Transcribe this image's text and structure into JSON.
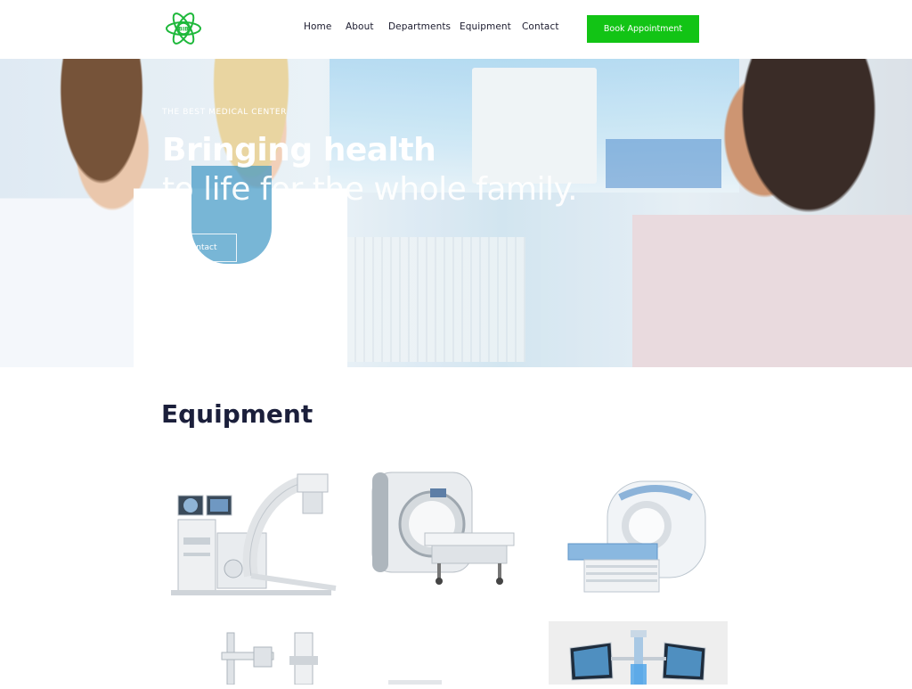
{
  "header": {
    "logo_text": "BIB",
    "nav": [
      "Home",
      "About",
      "Departments",
      "Equipment",
      "Contact"
    ],
    "cta_label": "Book Appointment",
    "cta_color": "#12c415"
  },
  "hero": {
    "eyebrow": "THE BEST MEDICAL CENTER",
    "title_bold": "Bringing health",
    "title_light": "to life for the whole family.",
    "button_label": "Contact"
  },
  "equipment": {
    "title": "Equipment",
    "items": [
      {
        "icon": "c-arm-xray-icon"
      },
      {
        "icon": "mri-scanner-icon"
      },
      {
        "icon": "ct-scanner-icon"
      },
      {
        "icon": "digital-radiography-icon"
      },
      {
        "icon": "ultrasound-icon"
      },
      {
        "icon": "xray-monitors-icon"
      }
    ]
  }
}
